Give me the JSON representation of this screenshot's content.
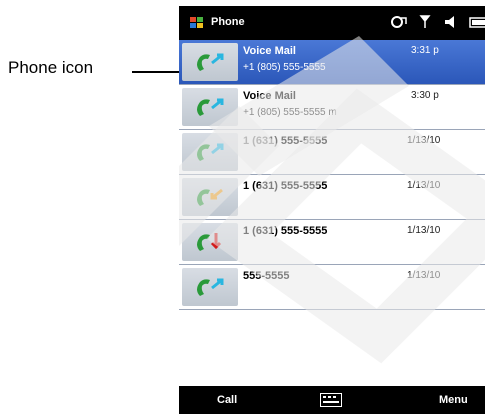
{
  "callout": {
    "label": "Phone icon"
  },
  "status_bar": {
    "title": "Phone",
    "icons": [
      "windows-start-icon",
      "connectivity-icon",
      "signal-icon",
      "volume-icon",
      "battery-icon"
    ]
  },
  "call_log": [
    {
      "name": "Voice Mail",
      "number": "+1 (805) 555-5555",
      "time": "3:31 p",
      "icon": "outgoing-call-icon"
    },
    {
      "name": "Voice Mail",
      "number": "+1 (805) 555-5555 m",
      "time": "3:30 p",
      "icon": "outgoing-call-icon"
    },
    {
      "name": "1 (631) 555-5555",
      "number": "",
      "time": "1/13/10",
      "icon": "outgoing-call-icon"
    },
    {
      "name": "1 (631) 555-5555",
      "number": "",
      "time": "1/13/10",
      "icon": "incoming-call-icon"
    },
    {
      "name": "1 (631) 555-5555",
      "number": "",
      "time": "1/13/10",
      "icon": "missed-call-icon"
    },
    {
      "name": "555-5555",
      "number": "",
      "time": "1/13/10",
      "icon": "outgoing-call-icon"
    }
  ],
  "softkeys": {
    "left": "Call",
    "right": "Menu"
  },
  "colors": {
    "selection": "#2f5fc4",
    "bar": "#000000",
    "handset": "#2a9a3a",
    "arrow_outgoing": "#29b6e0",
    "arrow_missed": "#d21b1b"
  }
}
